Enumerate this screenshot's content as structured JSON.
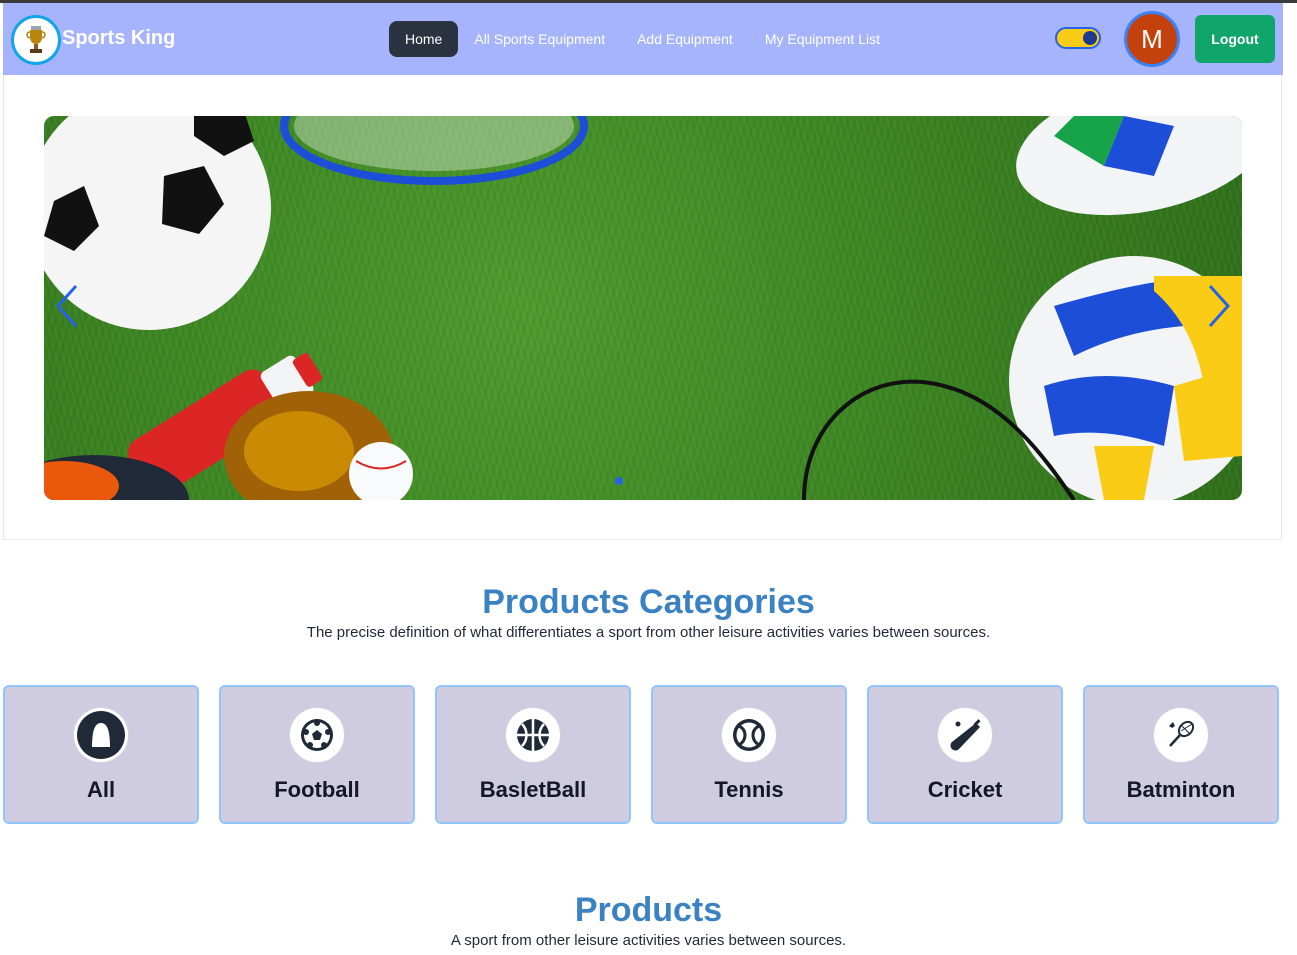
{
  "navbar": {
    "brand": "Sports King",
    "links": [
      {
        "label": "Home",
        "active": true
      },
      {
        "label": "All Sports Equipment",
        "active": false
      },
      {
        "label": "Add Equipment",
        "active": false
      },
      {
        "label": "My Equipment List",
        "active": false
      }
    ],
    "avatar_initial": "M",
    "logout_label": "Logout",
    "theme_toggle": "on",
    "logo_icon": "trophy-icon"
  },
  "hero": {
    "carousel_icons": [
      "chevron-left-icon",
      "chevron-right-icon"
    ],
    "active_slide": 1,
    "slides_count": 1
  },
  "categories_section": {
    "title": "Products Categories",
    "subtitle": "The precise definition of what differentiates a sport from other leisure activities varies between sources.",
    "items": [
      {
        "label": "All",
        "icon": "all-icon"
      },
      {
        "label": "Football",
        "icon": "football-icon"
      },
      {
        "label": "BasletBall",
        "icon": "basketball-icon"
      },
      {
        "label": "Tennis",
        "icon": "tennis-ball-icon"
      },
      {
        "label": "Cricket",
        "icon": "cricket-bat-icon"
      },
      {
        "label": "Batminton",
        "icon": "badminton-racket-icon"
      }
    ]
  },
  "products_section": {
    "title": "Products",
    "subtitle": "A sport from other leisure activities varies between sources."
  },
  "colors": {
    "navbar_bg": "#a5b4fc",
    "accent_title": "#3b82c4",
    "logout_bg": "#10a56a",
    "card_bg": "#cfcbe0"
  }
}
